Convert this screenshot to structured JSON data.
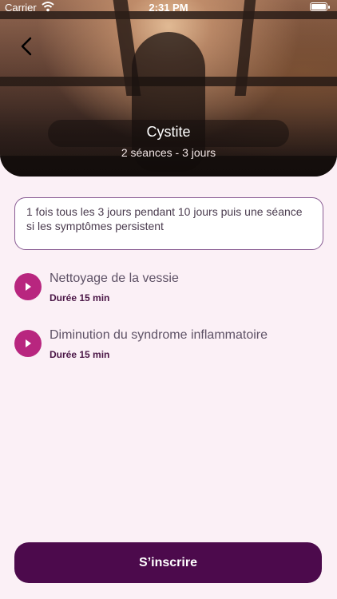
{
  "status_bar": {
    "carrier": "Carrier",
    "time": "2:31 PM"
  },
  "hero": {
    "title": "Cystite",
    "subtitle": "2 séances - 3 jours"
  },
  "note": "1 fois tous les 3 jours pendant 10 jours puis une séance si les symptômes persistent",
  "sessions": [
    {
      "name": "Nettoyage de la vessie",
      "duration": "Durée 15 min"
    },
    {
      "name": "Diminution du syndrome inflammatoire",
      "duration": "Durée 15 min"
    }
  ],
  "cta_label": "S’inscrire",
  "colors": {
    "accent": "#b8267f",
    "button": "#4c0a4c",
    "background": "#fbf0f6",
    "border": "#8a5d94"
  }
}
